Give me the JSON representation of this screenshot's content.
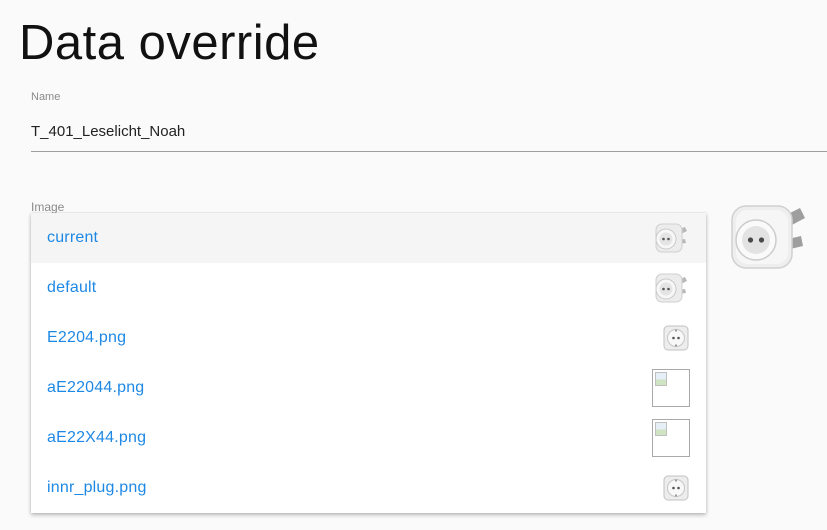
{
  "page": {
    "title": "Data override"
  },
  "name_field": {
    "label": "Name",
    "value": "T_401_Leselicht_Noah"
  },
  "image_field": {
    "label": "Image",
    "selected_preview_icon": "smart-plug-icon",
    "options": [
      {
        "label": "current",
        "thumb": "smart-plug-icon",
        "active": true
      },
      {
        "label": "default",
        "thumb": "smart-plug-icon",
        "active": false
      },
      {
        "label": "E2204.png",
        "thumb": "socket-front-icon",
        "active": false
      },
      {
        "label": "aE22044.png",
        "thumb": "broken-image-icon",
        "active": false
      },
      {
        "label": "aE22X44.png",
        "thumb": "broken-image-icon",
        "active": false
      },
      {
        "label": "innr_plug.png",
        "thumb": "socket-front-icon",
        "active": false
      }
    ]
  },
  "colors": {
    "option_text": "#1e88e5",
    "active_row": "#f5f5f5"
  }
}
